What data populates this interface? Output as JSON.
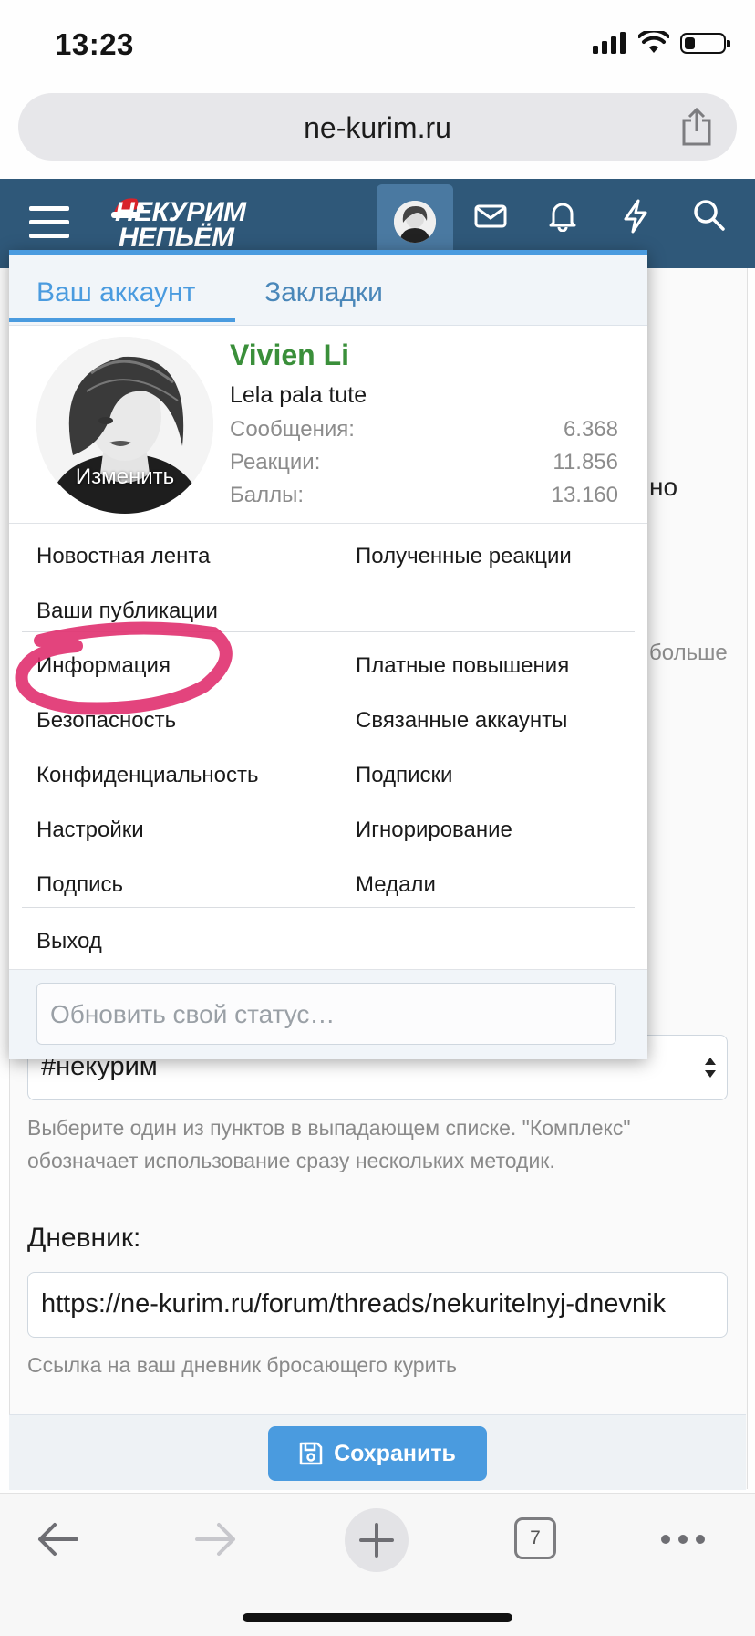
{
  "status_bar": {
    "time": "13:23"
  },
  "browser": {
    "url": "ne-kurim.ru"
  },
  "site": {
    "logo_line1": "НЕКУРИМ",
    "logo_line2": "НЕПЬЁМ"
  },
  "popup": {
    "tabs": [
      {
        "label": "Ваш аккаунт",
        "active": true
      },
      {
        "label": "Закладки",
        "active": false
      }
    ],
    "profile": {
      "change_label": "Изменить",
      "username": "Vivien Li",
      "user_title": "Lela pala tute",
      "stats": [
        {
          "label": "Сообщения:",
          "value": "6.368"
        },
        {
          "label": "Реакции:",
          "value": "11.856"
        },
        {
          "label": "Баллы:",
          "value": "13.160"
        }
      ]
    },
    "menu_group1": [
      "Новостная лента",
      "Полученные реакции",
      "Ваши публикации"
    ],
    "menu_group2": [
      "Информация",
      "Платные повышения",
      "Безопасность",
      "Связанные аккаунты",
      "Конфиденциальность",
      "Подписки",
      "Настройки",
      "Игнорирование",
      "Подпись",
      "Медали"
    ],
    "logout_label": "Выход",
    "status_placeholder": "Обновить свой статус…"
  },
  "background_page": {
    "fragment_right": "но",
    "fragment_more": "больше",
    "select_value": "#некурим",
    "select_hint": "Выберите один из пунктов в выпадающем списке. \"Комплекс\" обозначает использование сразу нескольких методик.",
    "diary_label": "Дневник:",
    "diary_value": "https://ne-kurim.ru/forum/threads/nekuritelnyj-dnevnik",
    "diary_hint": "Ссылка на ваш дневник бросающего курить",
    "save_label": "Сохранить"
  },
  "toolbar": {
    "tab_count": "7"
  },
  "colors": {
    "header": "#2f5879",
    "accent": "#4a9bdf",
    "username": "#3a8f3a",
    "highlight": "#e0306f"
  }
}
